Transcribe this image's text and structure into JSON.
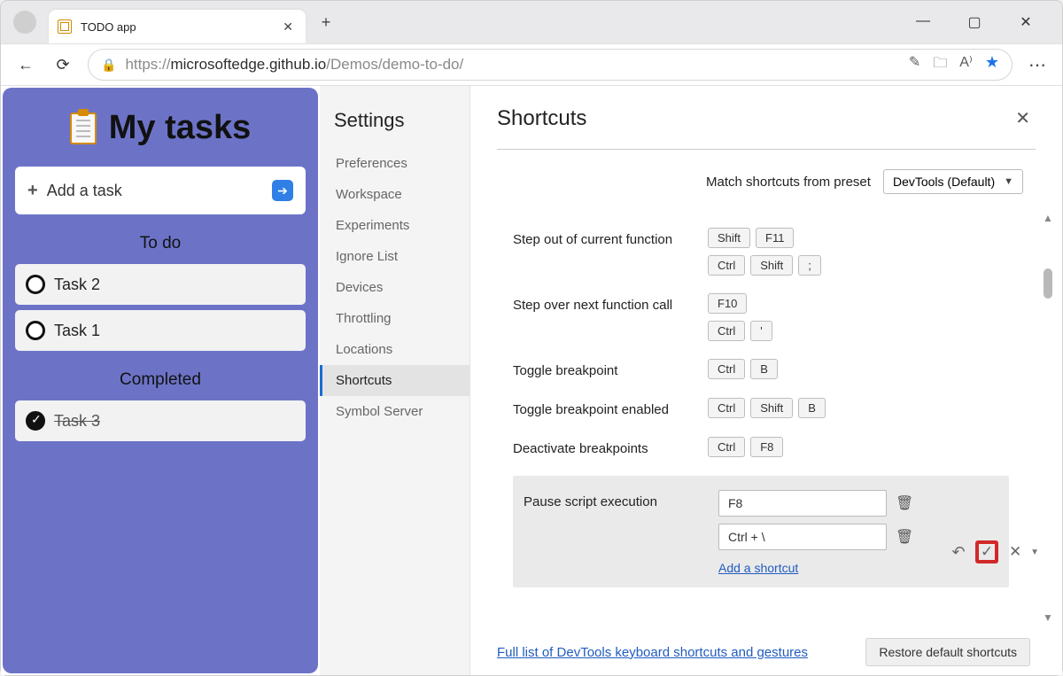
{
  "browser": {
    "tab_title": "TODO app",
    "url_prefix": "https://",
    "url_host": "microsoftedge.github.io",
    "url_path": "/Demos/demo-to-do/",
    "window_minimize": "—",
    "window_maximize": "▢",
    "window_close": "✕",
    "newtab": "+",
    "back": "←",
    "refresh": "⟳",
    "more": "⋯"
  },
  "todo": {
    "title": "My tasks",
    "add_placeholder": "Add a task",
    "section_todo": "To do",
    "section_done": "Completed",
    "tasks_open": [
      "Task 2",
      "Task 1"
    ],
    "tasks_done": [
      "Task 3"
    ]
  },
  "settings": {
    "heading": "Settings",
    "items": [
      "Preferences",
      "Workspace",
      "Experiments",
      "Ignore List",
      "Devices",
      "Throttling",
      "Locations",
      "Shortcuts",
      "Symbol Server"
    ],
    "active_index": 7
  },
  "shortcuts": {
    "title": "Shortcuts",
    "preset_label": "Match shortcuts from preset",
    "preset_value": "DevTools (Default)",
    "rows": [
      {
        "label": "Step out of current function",
        "combos": [
          [
            "Shift",
            "F11"
          ],
          [
            "Ctrl",
            "Shift",
            ";"
          ]
        ]
      },
      {
        "label": "Step over next function call",
        "combos": [
          [
            "F10"
          ],
          [
            "Ctrl",
            "'"
          ]
        ]
      },
      {
        "label": "Toggle breakpoint",
        "combos": [
          [
            "Ctrl",
            "B"
          ]
        ]
      },
      {
        "label": "Toggle breakpoint enabled",
        "combos": [
          [
            "Ctrl",
            "Shift",
            "B"
          ]
        ]
      },
      {
        "label": "Deactivate breakpoints",
        "combos": [
          [
            "Ctrl",
            "F8"
          ]
        ]
      }
    ],
    "editing": {
      "label": "Pause script execution",
      "inputs": [
        "F8",
        "Ctrl + \\"
      ],
      "add_link": "Add a shortcut"
    },
    "footer_link": "Full list of DevTools keyboard shortcuts and gestures",
    "restore_button": "Restore default shortcuts"
  }
}
